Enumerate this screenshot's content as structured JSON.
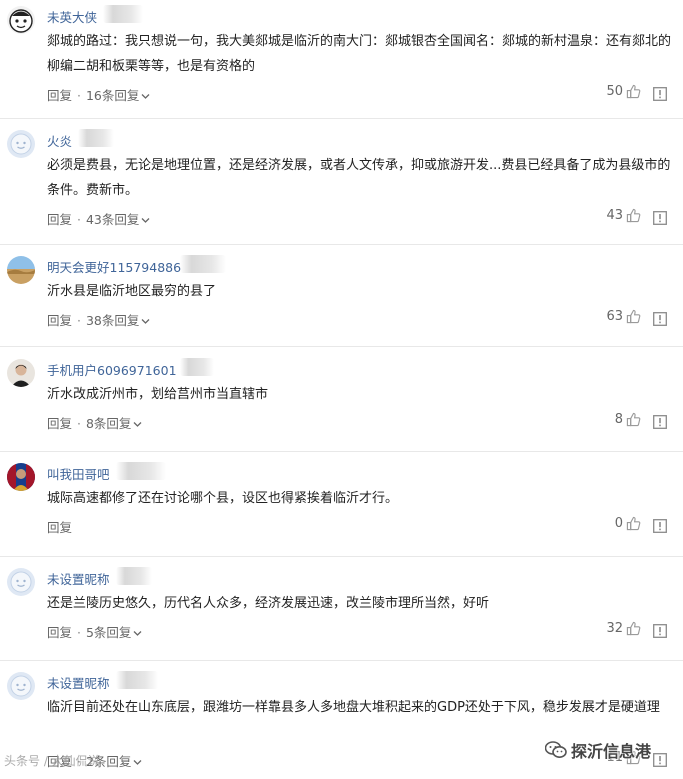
{
  "comments": [
    {
      "username": "未英大侠",
      "avatar": "cartoon-face-avatar",
      "text": "郯城的路过：我只想说一句，我大美郯城是临沂的南大门：郯城银杏全国闻名：郯城的新村温泉：还有郯北的柳编二胡和板栗等等，也是有资格的",
      "reply_label": "回复",
      "replies_label": "16条回复",
      "likes": "50"
    },
    {
      "username": "火炎",
      "avatar": "default-avatar",
      "text": "必须是费县，无论是地理位置，还是经济发展，或者人文传承，抑或旅游开发...费县已经具备了成为县级市的条件。费新市。",
      "reply_label": "回复",
      "replies_label": "43条回复",
      "likes": "43"
    },
    {
      "username": "明天会更好115794886",
      "avatar": "landscape-avatar",
      "text": "沂水县是临沂地区最穷的县了",
      "reply_label": "回复",
      "replies_label": "38条回复",
      "likes": "63"
    },
    {
      "username": "手机用户6096971601",
      "avatar": "person-avatar",
      "text": "沂水改成沂州市，划给莒州市当直辖市",
      "reply_label": "回复",
      "replies_label": "8条回复",
      "likes": "8"
    },
    {
      "username": "叫我田哥吧",
      "avatar": "sports-avatar",
      "text": "城际高速都修了还在讨论哪个县，设区也得紧挨着临沂才行。",
      "reply_label": "回复",
      "replies_label": "",
      "likes": "0"
    },
    {
      "username": "未设置昵称",
      "avatar": "default-avatar",
      "text": "还是兰陵历史悠久，历代名人众多，经济发展迅速，改兰陵市理所当然，好听",
      "reply_label": "回复",
      "replies_label": "5条回复",
      "likes": "32"
    },
    {
      "username": "未设置昵称",
      "avatar": "default-avatar",
      "text": "临沂目前还处在山东底层，跟潍坊一样靠县多人多地盘大堆积起来的GDP还处于下风，稳步发展才是硬道理",
      "reply_label": "回复",
      "replies_label": "2条回复",
      "likes": "11"
    }
  ],
  "watermarks": {
    "left": "头条号 / 大仙侃说",
    "right": "探沂信息港"
  },
  "colors": {
    "username": "#406599",
    "text": "#222222",
    "meta": "#666666",
    "divider": "#e8e8e8"
  }
}
